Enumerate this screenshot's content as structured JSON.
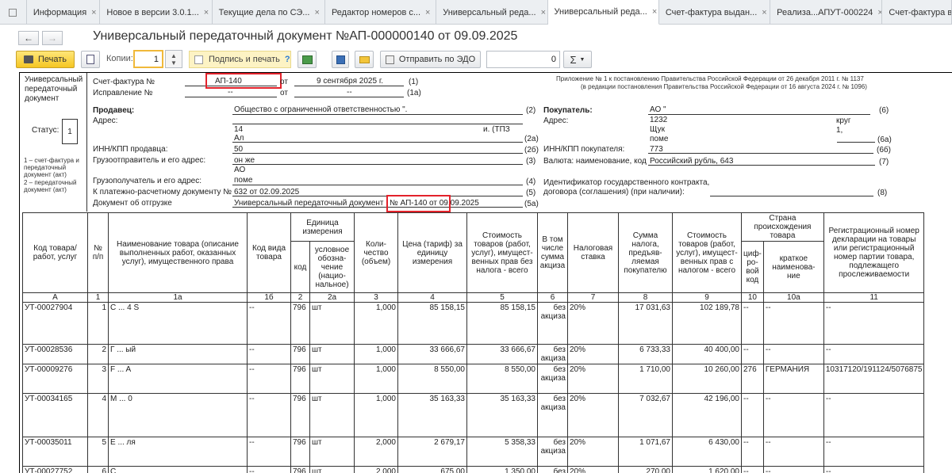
{
  "tabs": [
    {
      "label": "Информация",
      "close": "×"
    },
    {
      "label": "Новое в версии 3.0.1...",
      "close": "×"
    },
    {
      "label": "Текущие дела по СЭ...",
      "close": "×"
    },
    {
      "label": "Редактор номеров с...",
      "close": "×"
    },
    {
      "label": "Универсальный реда...",
      "close": "×"
    },
    {
      "label": "Универсальный реда...",
      "close": "×"
    },
    {
      "label": "Счет-фактура выдан...",
      "close": "×"
    },
    {
      "label": "Реализа...АПУТ-000224",
      "close": "×"
    },
    {
      "label": "Счет-фактура выд",
      "close": ""
    }
  ],
  "header": {
    "title": "Универсальный передаточный документ №АП-000000140 от 09.09.2025",
    "back_icon": "arrow-left-icon",
    "forward_icon": "arrow-right-icon"
  },
  "toolbar": {
    "print_label": "Печать",
    "copies_label": "Копии:",
    "copies_value": "1",
    "sign_print_label": "Подпись и печать",
    "sign_help": "?",
    "send_edo_label": "Отправить по ЭДО",
    "count_value": "0",
    "sigma_label": "Σ",
    "accent_color": "#f5c623"
  },
  "doc": {
    "side_title": [
      "Универсальный",
      "передаточный",
      "документ"
    ],
    "status_label": "Статус:",
    "status_value": "1",
    "status_note": [
      "1 – счет-фактура и",
      "передаточный",
      "документ (акт)",
      "2 – передаточный",
      "документ (акт)"
    ],
    "invoice_label": "Счет-фактура №",
    "invoice_number": "АП-140",
    "from_label": "от",
    "invoice_date": "9 сентября 2025 г.",
    "code_1": "(1)",
    "correction_label": "Исправление №",
    "correction_no": "--",
    "correction_date": "--",
    "code_1a": "(1а)",
    "appendix_1": "Приложение № 1 к постановлению Правительства Российской Федерации от 26 декабря 2011 г. № 1137",
    "appendix_2": "(в редакции постановления Правительства Российской Федерации от 16 августа 2024 г. № 1096)",
    "seller_label": "Продавец:",
    "seller_value": "Общество с ограниченной ответственностью \".",
    "code_2": "(2)",
    "address_label": "Адрес:",
    "address_line1": "14",
    "address_line2": "Ал",
    "address_tail": "и. (ТПЗ",
    "code_2a": "(2а)",
    "inn_seller_label": "ИНН/КПП продавца:",
    "inn_seller_value": "50",
    "code_2b": "(2б)",
    "shipper_label": "Грузоотправитель и его адрес:",
    "shipper_value": "он же",
    "code_3": "(3)",
    "consignee_label": "Грузополучатель и его адрес:",
    "consignee_line1": "АО",
    "consignee_line2": "поме",
    "code_4": "(4)",
    "payment_label": "К платежно-расчетному документу №",
    "payment_value": "632 от 02.09.2025",
    "code_5": "(5)",
    "shipment_label": "Документ об отгрузке",
    "shipment_value": "Универсальный передаточный документ",
    "shipment_number": "№ АП-140 от 09.09.2025",
    "code_5a": "(5а)",
    "buyer_label": "Покупатель:",
    "buyer_value": "АО \"",
    "code_6": "(6)",
    "buyer_address_label": "Адрес:",
    "buyer_address_1": "1232",
    "buyer_address_2": "Щук",
    "buyer_address_3": "поме",
    "buyer_address_right1": "круг",
    "buyer_address_right2": "1,",
    "code_6a": "(6а)",
    "inn_buyer_label": "ИНН/КПП покупателя:",
    "inn_buyer_value": "773",
    "code_6b": "(6б)",
    "currency_label": "Валюта: наименование, код",
    "currency_value": "Российский рубль, 643",
    "code_7": "(7)",
    "gov_contract_label_1": "Идентификатор государственного контракта,",
    "gov_contract_label_2": "договора (соглашения) (при наличии):",
    "code_8": "(8)"
  },
  "table": {
    "headers": {
      "code": "Код товара/ работ, услуг",
      "np": "№ п/п",
      "name": "Наименование товара (описание выполненных работ, оказанных услуг), имущественного права",
      "kind": "Код вида товара",
      "unit": "Единица измерения",
      "unit_code": "код",
      "unit_name": "условное обозна- чение (нацио- нальное)",
      "qty": "Коли- чество (объем)",
      "price": "Цена (тариф) за единицу измерения",
      "cost_wo_tax": "Стоимость товаров (работ, услуг), имущест- венных прав без налога - всего",
      "excise": "В том числе сумма акциза",
      "rate": "Налоговая ставка",
      "tax": "Сумма налога, предъяв- ляемая покупателю",
      "cost_with_tax": "Стоимость товаров (работ, услуг), имущест- венных прав с налогом - всего",
      "country": "Страна происхождения товара",
      "country_code": "циф- ро- вой код",
      "country_name": "краткое наименова- ние",
      "decl": "Регистрационный номер декларации на товары или регистрационный номер партии товара, подлежащего прослеживаемости"
    },
    "index_row": [
      "А",
      "1",
      "1а",
      "1б",
      "2",
      "2а",
      "3",
      "4",
      "5",
      "6",
      "7",
      "8",
      "9",
      "10",
      "10а",
      "11"
    ],
    "rows": [
      {
        "code": "УТ-00027904",
        "np": "1",
        "name": "С ... 4 S",
        "kind": "--",
        "unit_code": "796",
        "unit": "шт",
        "qty": "1,000",
        "price": "85 158,15",
        "cost": "85 158,15",
        "excise": "без акциза",
        "rate": "20%",
        "tax": "17 031,63",
        "total": "102 189,78",
        "ccode": "--",
        "cname": "--",
        "decl": "--"
      },
      {
        "code": "УТ-00028536",
        "np": "2",
        "name": "Г ... ый",
        "kind": "--",
        "unit_code": "796",
        "unit": "шт",
        "qty": "1,000",
        "price": "33 666,67",
        "cost": "33 666,67",
        "excise": "без акциза",
        "rate": "20%",
        "tax": "6 733,33",
        "total": "40 400,00",
        "ccode": "--",
        "cname": "--",
        "decl": "--"
      },
      {
        "code": "УТ-00009276",
        "np": "3",
        "name": "F ... A",
        "kind": "--",
        "unit_code": "796",
        "unit": "шт",
        "qty": "1,000",
        "price": "8 550,00",
        "cost": "8 550,00",
        "excise": "без акциза",
        "rate": "20%",
        "tax": "1 710,00",
        "total": "10 260,00",
        "ccode": "276",
        "cname": "ГЕРМАНИЯ",
        "decl": "10317120/191124/5076875"
      },
      {
        "code": "УТ-00034165",
        "np": "4",
        "name": "М ... 0",
        "kind": "--",
        "unit_code": "796",
        "unit": "шт",
        "qty": "1,000",
        "price": "35 163,33",
        "cost": "35 163,33",
        "excise": "без акциза",
        "rate": "20%",
        "tax": "7 032,67",
        "total": "42 196,00",
        "ccode": "--",
        "cname": "--",
        "decl": "--"
      },
      {
        "code": "УТ-00035011",
        "np": "5",
        "name": "Е ... ля",
        "kind": "--",
        "unit_code": "796",
        "unit": "шт",
        "qty": "2,000",
        "price": "2 679,17",
        "cost": "5 358,33",
        "excise": "без акциза",
        "rate": "20%",
        "tax": "1 071,67",
        "total": "6 430,00",
        "ccode": "--",
        "cname": "--",
        "decl": "--"
      },
      {
        "code": "УТ-00027752",
        "np": "6",
        "name": "С",
        "kind": "--",
        "unit_code": "796",
        "unit": "шт",
        "qty": "2,000",
        "price": "675,00",
        "cost": "1 350,00",
        "excise": "без акциза",
        "rate": "20%",
        "tax": "270,00",
        "total": "1 620,00",
        "ccode": "--",
        "cname": "--",
        "decl": "--"
      }
    ]
  }
}
